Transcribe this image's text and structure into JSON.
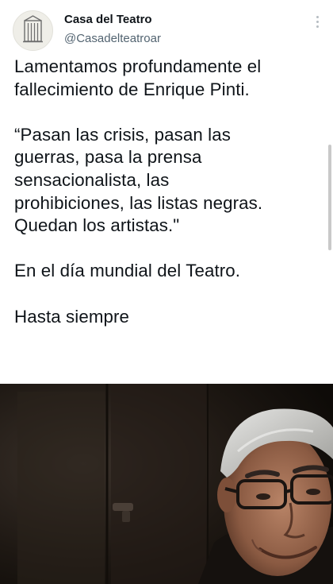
{
  "account": {
    "name": "Casa del Teatro",
    "handle": "@Casadelteatroar",
    "avatar_icon": "theatre-building-logo-icon"
  },
  "more_icon": "more-options-icon",
  "tweet": {
    "paragraph_1": "Lamentamos profundamente el fallecimiento de Enrique Pinti.",
    "quote_line_1": "“Pasan las crisis, pasan las",
    "quote_line_2": "guerras, pasa la prensa",
    "quote_line_3": "sensacionalista, las",
    "quote_line_4": "prohibiciones, las listas negras.",
    "quote_line_5": "Quedan los artistas.\"",
    "paragraph_3": "En el día mundial del Teatro.",
    "paragraph_4": "Hasta siempre"
  },
  "media": {
    "type": "photo",
    "subject": "portrait-photo"
  },
  "colors": {
    "text": "#0f1419",
    "secondary": "#536471",
    "background": "#ffffff"
  }
}
